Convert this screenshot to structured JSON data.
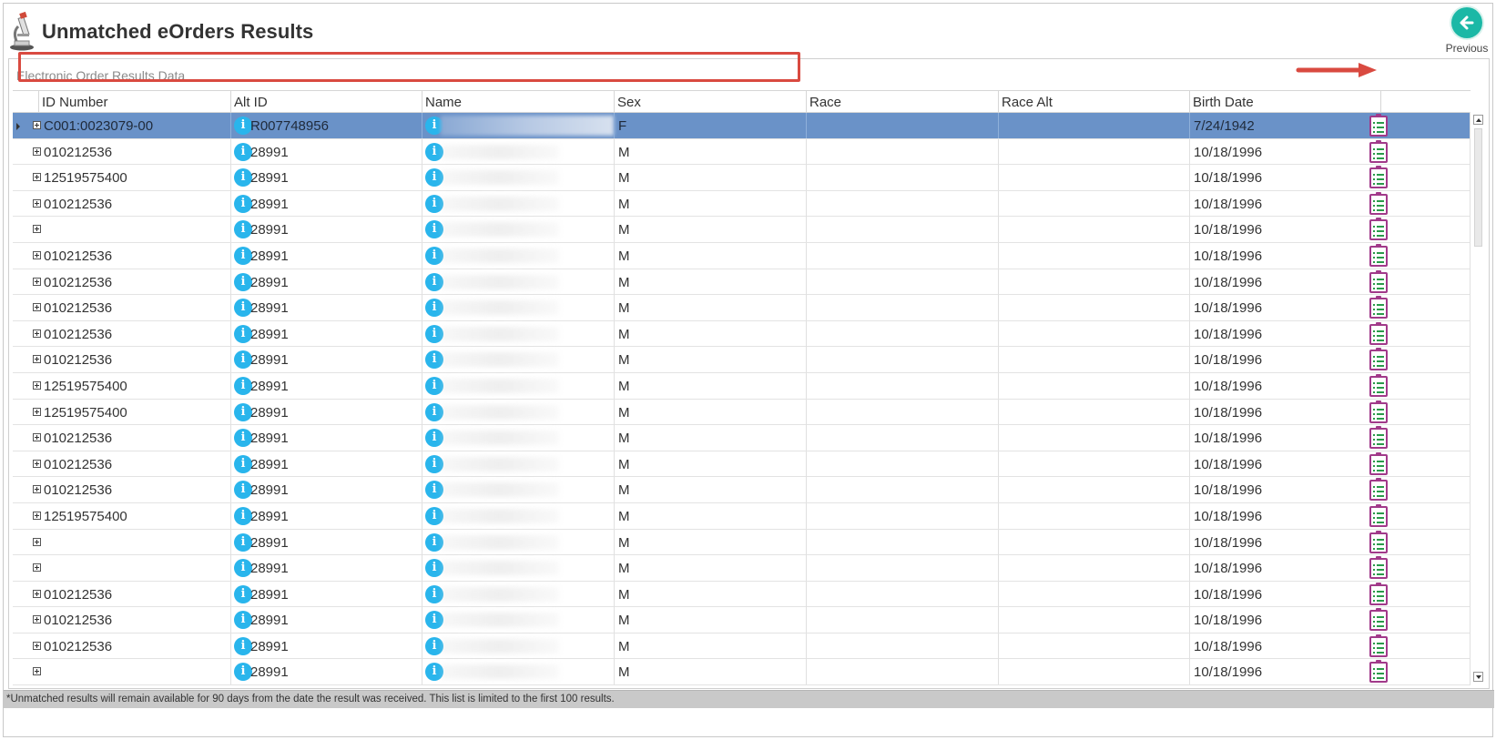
{
  "header": {
    "title": "Unmatched eOrders Results",
    "previous_label": "Previous"
  },
  "panel": {
    "title": "Electronic Order Results Data"
  },
  "grid": {
    "columns": [
      "ID Number",
      "Alt ID",
      "Name",
      "Sex",
      "Race",
      "Race Alt",
      "Birth Date"
    ],
    "rows": [
      {
        "id": "C001:0023079-00",
        "alt_id": "R007748956",
        "sex": "F",
        "race": "",
        "race_alt": "",
        "birth_date": "7/24/1942"
      },
      {
        "id": "010212536",
        "alt_id": "28991",
        "sex": "M",
        "race": "",
        "race_alt": "",
        "birth_date": "10/18/1996"
      },
      {
        "id": "12519575400",
        "alt_id": "28991",
        "sex": "M",
        "race": "",
        "race_alt": "",
        "birth_date": "10/18/1996"
      },
      {
        "id": "010212536",
        "alt_id": "28991",
        "sex": "M",
        "race": "",
        "race_alt": "",
        "birth_date": "10/18/1996"
      },
      {
        "id": "",
        "alt_id": "28991",
        "sex": "M",
        "race": "",
        "race_alt": "",
        "birth_date": "10/18/1996"
      },
      {
        "id": "010212536",
        "alt_id": "28991",
        "sex": "M",
        "race": "",
        "race_alt": "",
        "birth_date": "10/18/1996"
      },
      {
        "id": "010212536",
        "alt_id": "28991",
        "sex": "M",
        "race": "",
        "race_alt": "",
        "birth_date": "10/18/1996"
      },
      {
        "id": "010212536",
        "alt_id": "28991",
        "sex": "M",
        "race": "",
        "race_alt": "",
        "birth_date": "10/18/1996"
      },
      {
        "id": "010212536",
        "alt_id": "28991",
        "sex": "M",
        "race": "",
        "race_alt": "",
        "birth_date": "10/18/1996"
      },
      {
        "id": "010212536",
        "alt_id": "28991",
        "sex": "M",
        "race": "",
        "race_alt": "",
        "birth_date": "10/18/1996"
      },
      {
        "id": "12519575400",
        "alt_id": "28991",
        "sex": "M",
        "race": "",
        "race_alt": "",
        "birth_date": "10/18/1996"
      },
      {
        "id": "12519575400",
        "alt_id": "28991",
        "sex": "M",
        "race": "",
        "race_alt": "",
        "birth_date": "10/18/1996"
      },
      {
        "id": "010212536",
        "alt_id": "28991",
        "sex": "M",
        "race": "",
        "race_alt": "",
        "birth_date": "10/18/1996"
      },
      {
        "id": "010212536",
        "alt_id": "28991",
        "sex": "M",
        "race": "",
        "race_alt": "",
        "birth_date": "10/18/1996"
      },
      {
        "id": "010212536",
        "alt_id": "28991",
        "sex": "M",
        "race": "",
        "race_alt": "",
        "birth_date": "10/18/1996"
      },
      {
        "id": "12519575400",
        "alt_id": "28991",
        "sex": "M",
        "race": "",
        "race_alt": "",
        "birth_date": "10/18/1996"
      },
      {
        "id": "",
        "alt_id": "28991",
        "sex": "M",
        "race": "",
        "race_alt": "",
        "birth_date": "10/18/1996"
      },
      {
        "id": "",
        "alt_id": "28991",
        "sex": "M",
        "race": "",
        "race_alt": "",
        "birth_date": "10/18/1996"
      },
      {
        "id": "010212536",
        "alt_id": "28991",
        "sex": "M",
        "race": "",
        "race_alt": "",
        "birth_date": "10/18/1996"
      },
      {
        "id": "010212536",
        "alt_id": "28991",
        "sex": "M",
        "race": "",
        "race_alt": "",
        "birth_date": "10/18/1996"
      },
      {
        "id": "010212536",
        "alt_id": "28991",
        "sex": "M",
        "race": "",
        "race_alt": "",
        "birth_date": "10/18/1996"
      },
      {
        "id": "",
        "alt_id": "28991",
        "sex": "M",
        "race": "",
        "race_alt": "",
        "birth_date": "10/18/1996"
      }
    ]
  },
  "footer": {
    "note": "*Unmatched results will remain available for 90 days from the date the result was received. This list is limited to the first 100 results."
  },
  "colors": {
    "selected_row": "#6a92c8",
    "accent_teal": "#1bb8a6",
    "info_blue": "#29b5ec",
    "annotation_red": "#d94a40",
    "doc_icon_purple": "#a13a8a"
  },
  "icons": {
    "app": "microscope-icon",
    "previous": "arrow-left-circle-icon",
    "info": "info-icon",
    "row_action": "clipboard-list-icon",
    "expander": "plus-box-icon"
  }
}
